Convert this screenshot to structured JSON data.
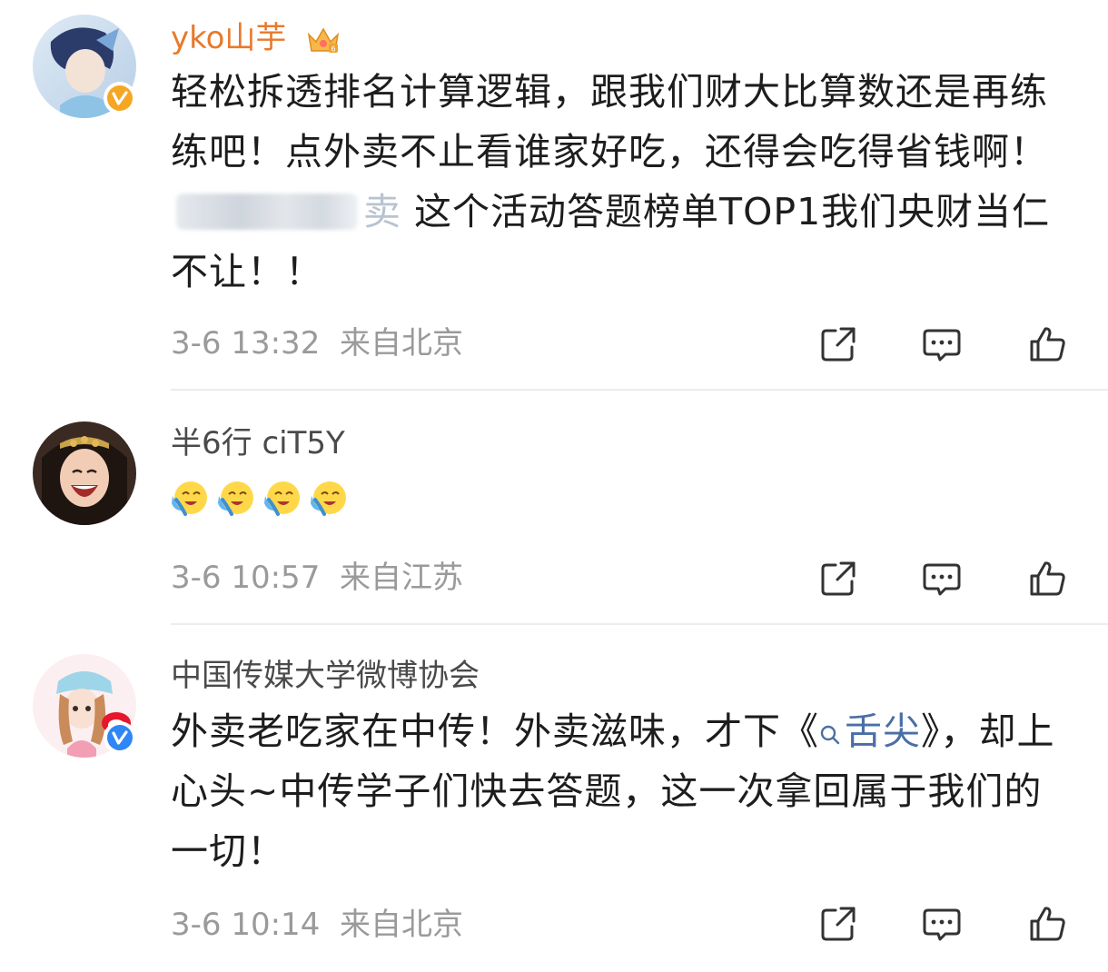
{
  "comments": [
    {
      "username": "yko山芋",
      "verified": true,
      "vip": true,
      "text_before": "轻松拆透排名计算逻辑，跟我们财大比算数还是再练练吧！点外卖不止看谁家好吃，还得会吃得省钱啊！",
      "blurred_tail": "卖",
      "text_after": " 这个活动答题榜单TOP1我们央财当仁不让！！",
      "time": "3-6 13:32",
      "location": "来自北京"
    },
    {
      "username": "半6行 ciT5Y",
      "verified": false,
      "emoji_names": [
        "crying-laughing-emoji",
        "crying-laughing-emoji",
        "crying-laughing-emoji",
        "crying-laughing-emoji"
      ],
      "time": "3-6 10:57",
      "location": "来自江苏"
    },
    {
      "username": "中国传媒大学微博协会",
      "verified": true,
      "text_before": "外卖老吃家在中传！外卖滋味，才下《",
      "topic": "舌尖",
      "text_after": "》，却上心头~中传学子们快去答题，这一次拿回属于我们的一切！",
      "time": "3-6 10:14",
      "location": "来自北京"
    }
  ],
  "icons": {
    "share": "share-icon",
    "comment": "comment-icon",
    "like": "thumbs-up-icon",
    "verified": "verified-v-icon",
    "vip": "crown-icon",
    "topic": "search-icon"
  },
  "colors": {
    "vip_name": "#e8792c",
    "topic_link": "#4a6fa5",
    "meta_text": "#9a9a9a",
    "verified_badge": "#f5a623"
  }
}
